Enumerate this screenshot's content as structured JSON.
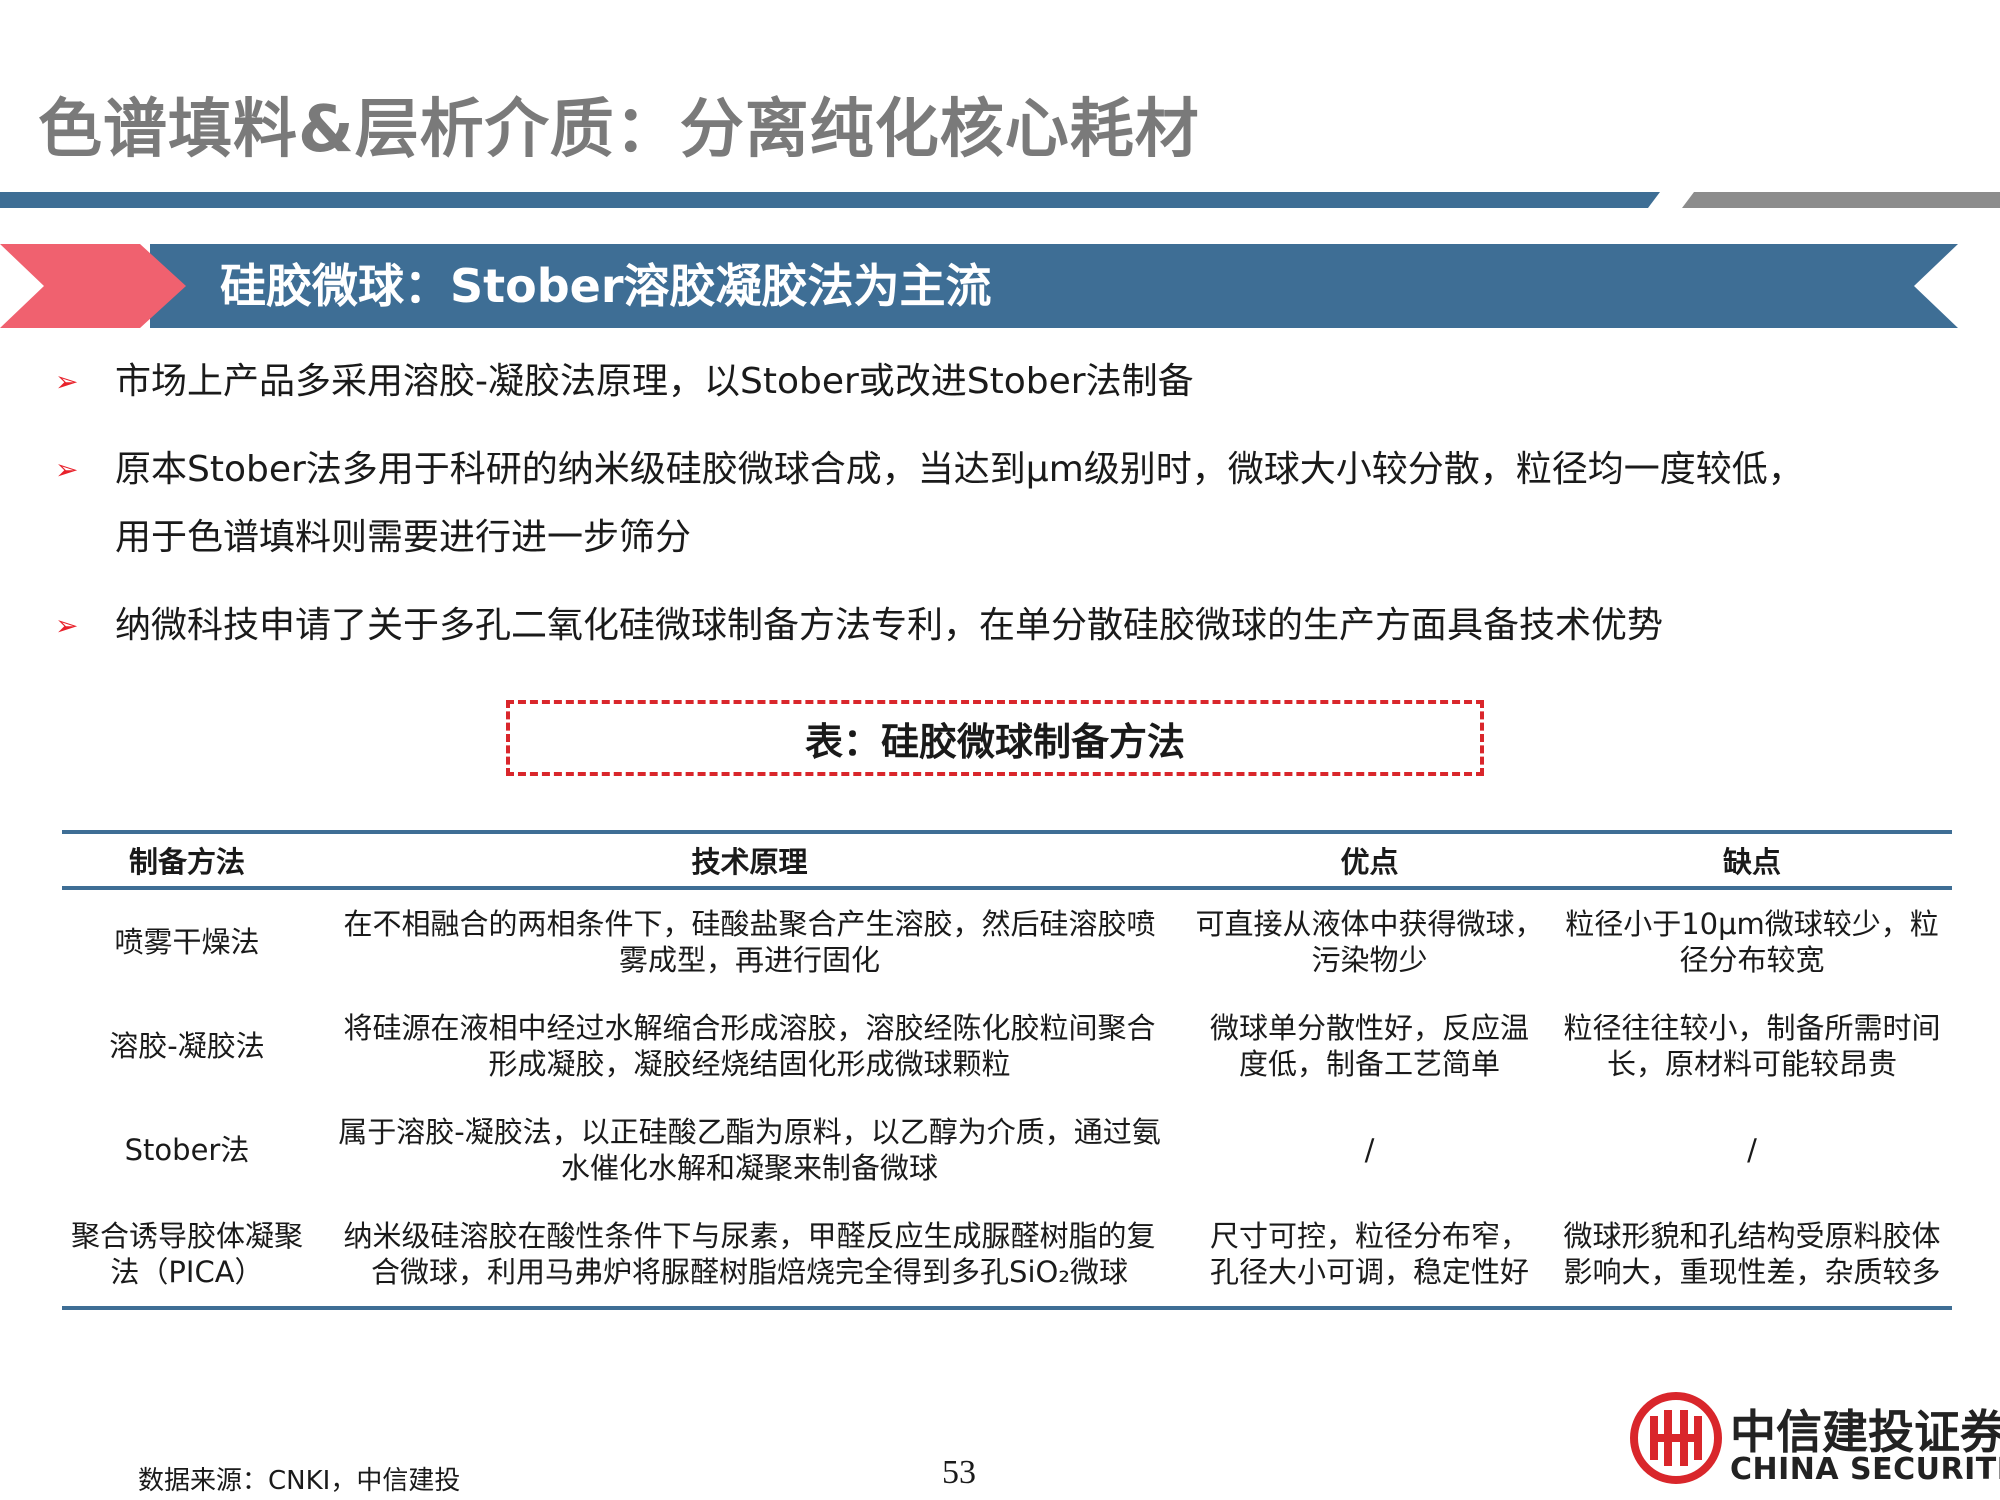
{
  "header": {
    "title": "色谱填料&层析介质：分离纯化核心耗材",
    "accent_color": "#3e6e95",
    "secondary_color": "#808080"
  },
  "section": {
    "title": "硅胶微球：Stober溶胶凝胶法为主流",
    "banner_color": "#3e6e95",
    "marker_color": "#f0616f"
  },
  "bullets": [
    {
      "icon": "red-arrow-icon",
      "lines": [
        "市场上产品多采用溶胶-凝胶法原理，以Stober或改进Stober法制备"
      ]
    },
    {
      "icon": "red-arrow-icon",
      "lines": [
        "原本Stober法多用于科研的纳米级硅胶微球合成，当达到μm级别时，微球大小较分散，粒径均一度较低，",
        "用于色谱填料则需要进行进一步筛分"
      ]
    },
    {
      "icon": "red-arrow-icon",
      "lines": [
        "纳微科技申请了关于多孔二氧化硅微球制备方法专利，在单分散硅胶微球的生产方面具备技术优势"
      ]
    }
  ],
  "table_caption": "表：硅胶微球制备方法",
  "table": {
    "headers": [
      "制备方法",
      "技术原理",
      "优点",
      "缺点"
    ],
    "rows": [
      {
        "method": [
          "喷雾干燥法"
        ],
        "principle": [
          "在不相融合的两相条件下，硅酸盐聚合产生溶胶，然后硅溶胶喷",
          "雾成型，再进行固化"
        ],
        "pros": [
          "可直接从液体中获得微球，",
          "污染物少"
        ],
        "cons": [
          "粒径小于10μm微球较少，粒",
          "径分布较宽"
        ]
      },
      {
        "method": [
          "溶胶-凝胶法"
        ],
        "principle": [
          "将硅源在液相中经过水解缩合形成溶胶，溶胶经陈化胶粒间聚合",
          "形成凝胶，凝胶经烧结固化形成微球颗粒"
        ],
        "pros": [
          "微球单分散性好，反应温",
          "度低，制备工艺简单"
        ],
        "cons": [
          "粒径往往较小，制备所需时间",
          "长，原材料可能较昂贵"
        ]
      },
      {
        "method": [
          "Stober法"
        ],
        "principle": [
          "属于溶胶-凝胶法，以正硅酸乙酯为原料，以乙醇为介质，通过氨",
          "水催化水解和凝聚来制备微球"
        ],
        "pros": [
          "/"
        ],
        "cons": [
          "/"
        ]
      },
      {
        "method": [
          "聚合诱导胶体凝聚",
          "法（PICA）"
        ],
        "principle": [
          "纳米级硅溶胶在酸性条件下与尿素，甲醛反应生成脲醛树脂的复",
          "合微球，利用马弗炉将脲醛树脂焙烧完全得到多孔SiO₂微球"
        ],
        "pros": [
          "尺寸可控，粒径分布窄，",
          "孔径大小可调，稳定性好"
        ],
        "cons": [
          "微球形貌和孔结构受原料胶体",
          "影响大，重现性差，杂质较多"
        ]
      }
    ]
  },
  "footer": {
    "source": "数据来源：CNKI，中信建投",
    "page_number": "53"
  },
  "logo": {
    "icon": "china-securities-logo-icon",
    "name_cn": "中信建投证券",
    "name_en": "CHINA SECURITIES",
    "color": "#d9262b"
  }
}
